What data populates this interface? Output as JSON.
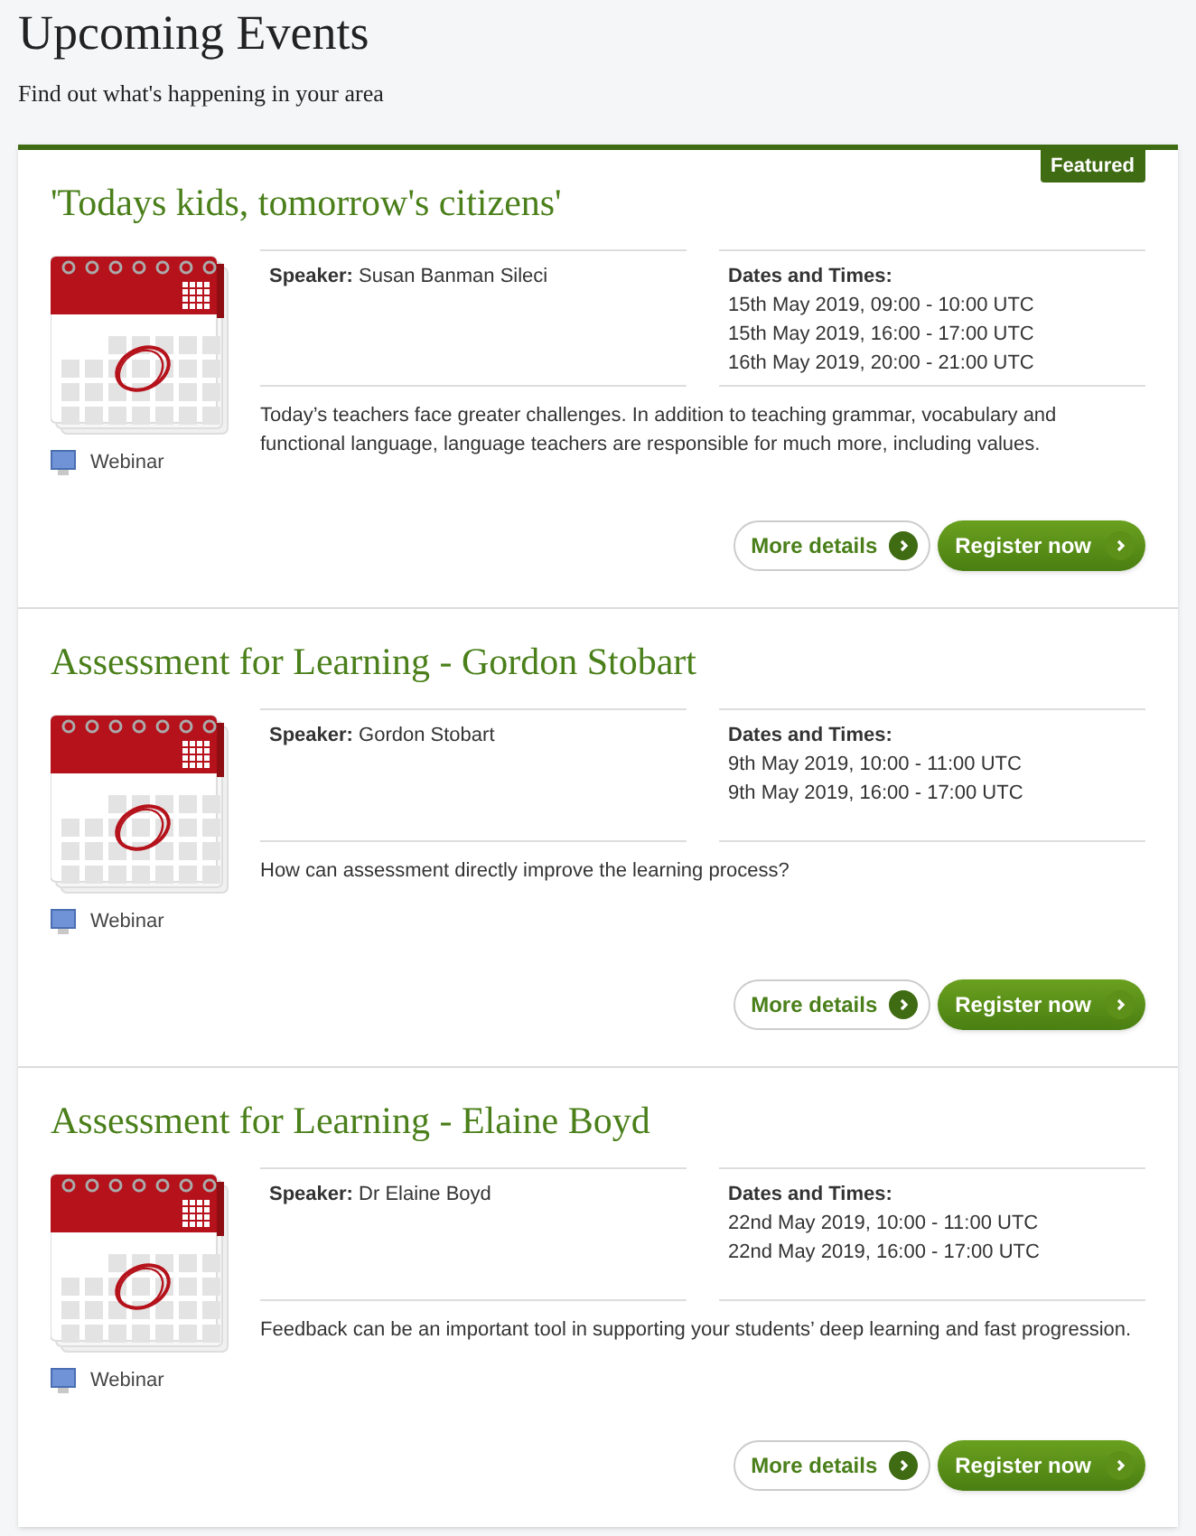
{
  "header": {
    "title": "Upcoming Events",
    "subtitle": "Find out what's happening in your area"
  },
  "events": [
    {
      "featured": true,
      "badge": "Featured",
      "title": "'Todays kids, tomorrow's citizens'",
      "speaker_label": "Speaker:",
      "speaker": "Susan Banman Sileci",
      "dates_label": "Dates and Times:",
      "dates": [
        "15th May 2019, 09:00 - 10:00 UTC",
        "15th May 2019, 16:00 - 17:00 UTC",
        "16th May 2019, 20:00 - 21:00 UTC"
      ],
      "type": "Webinar",
      "description": "Today’s teachers face greater challenges. In addition to teaching grammar, vocabulary and functional language, language teachers are responsible for much more, including values.",
      "more": "More details",
      "register": "Register now"
    },
    {
      "featured": false,
      "title": "Assessment for Learning - Gordon Stobart",
      "speaker_label": "Speaker:",
      "speaker": "Gordon Stobart",
      "dates_label": "Dates and Times:",
      "dates": [
        "9th May 2019, 10:00 - 11:00 UTC",
        "9th May 2019, 16:00 - 17:00 UTC"
      ],
      "type": "Webinar",
      "description": "How can assessment directly improve the learning process?",
      "more": "More details",
      "register": "Register now"
    },
    {
      "featured": false,
      "title": "Assessment for Learning - Elaine Boyd",
      "speaker_label": "Speaker:",
      "speaker": "Dr Elaine Boyd",
      "dates_label": "Dates and Times:",
      "dates": [
        "22nd May 2019, 10:00 - 11:00 UTC",
        "22nd May 2019, 16:00 - 17:00 UTC"
      ],
      "type": "Webinar",
      "description": "Feedback can be an important tool in supporting your students’ deep learning and fast progression.",
      "more": "More details",
      "register": "Register now"
    }
  ]
}
